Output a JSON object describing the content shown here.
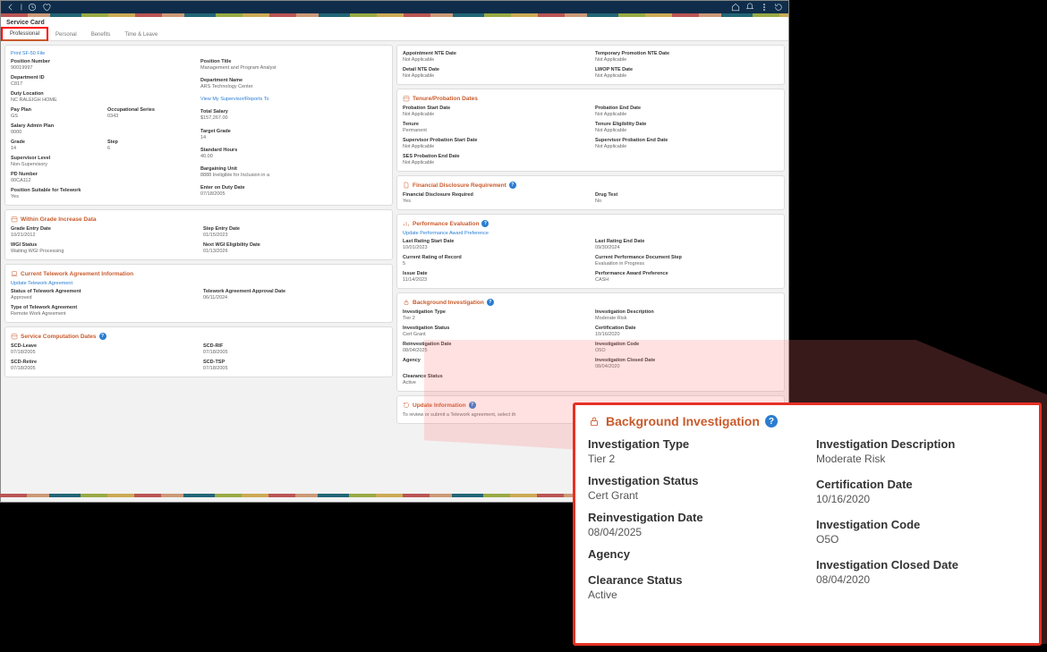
{
  "topbar": {
    "sep": "|"
  },
  "page_title": "Service Card",
  "tabs": [
    "Professional",
    "Personal",
    "Benefits",
    "Time & Leave"
  ],
  "left": {
    "profile": {
      "print": "Print SF-50 File",
      "position_number_l": "Position Number",
      "position_number": "90019997",
      "dept_id_l": "Department ID",
      "dept_id": "C817",
      "duty_loc_l": "Duty Location",
      "duty_loc": "NC RALEIGH HOME",
      "pay_plan_l": "Pay Plan",
      "pay_plan": "GS",
      "occ_series_l": "Occupational Series",
      "occ_series": "0343",
      "sal_plan_l": "Salary Admin Plan",
      "sal_plan": "0000",
      "grade_l": "Grade",
      "grade": "14",
      "step_l": "Step",
      "step": "6",
      "sup_l": "Supervisor Level",
      "sup": "Non-Supervisory",
      "pd_l": "PD Number",
      "pd": "00CA112",
      "tele_l": "Position Suitable for Telework",
      "tele": "Yes",
      "pos_title_l": "Position Title",
      "pos_title": "Management and Program Analyst",
      "dept_name_l": "Department Name",
      "dept_name": "ARS Technology Center",
      "view_sup": "View My Supervisor/Reports To",
      "total_sal_l": "Total Salary",
      "total_sal": "$157,267.00",
      "target_l": "Target Grade",
      "target": "14",
      "std_hours_l": "Standard Hours",
      "std_hours": "40.00",
      "barg_l": "Bargaining Unit",
      "barg": "8888   Ineligible for Inclusion in a",
      "eod_l": "Enter on Duty Date",
      "eod": "07/18/2005"
    },
    "wgi": {
      "title": "Within Grade Increase Data",
      "ged_l": "Grade Entry Date",
      "ged": "10/21/2012",
      "status_l": "WGI Status",
      "status": "Waiting WGI Processing",
      "sed_l": "Step Entry Date",
      "sed": "01/15/2023",
      "next_l": "Next WGI Eligibility Date",
      "next": "01/13/2026"
    },
    "tele": {
      "title": "Current Telework Agreement Information",
      "link": "Update Telework Agreement",
      "status_l": "Status of Telework Agreement",
      "status": "Approved",
      "type_l": "Type of Telework Agreement",
      "type": "Remote Work Agreement",
      "app_l": "Telework Agreement Approval Date",
      "app": "06/11/2024"
    },
    "scd": {
      "title": "Service Computation Dates",
      "leave_l": "SCD-Leave",
      "leave": "07/18/2005",
      "retire_l": "SCD-Retire",
      "retire": "07/18/2005",
      "rif_l": "SCD-RIF",
      "rif": "07/18/2005",
      "tsp_l": "SCD-TSP",
      "tsp": "07/18/2005"
    }
  },
  "right": {
    "appt": {
      "ante_l": "Appointment NTE Date",
      "ante": "Not Applicable",
      "dnte_l": "Detail NTE Date",
      "dnte": "Not Applicable",
      "tpnte_l": "Temporary Promotion NTE Date",
      "tpnte": "Not Applicable",
      "lwop_l": "LWOP NTE Date",
      "lwop": "Not Applicable"
    },
    "tenure": {
      "title": "Tenure/Probation Dates",
      "psd_l": "Probation Start Date",
      "psd": "Not Applicable",
      "ten_l": "Tenure",
      "ten": "Permanent",
      "spsd_l": "Supervisor Probation Start Date",
      "spsd": "Not Applicable",
      "ses_l": "SES Probation End Date",
      "ses": "Not Applicable",
      "ped_l": "Probation End Date",
      "ped": "Not Applicable",
      "ted_l": "Tenure Eligibility Date",
      "ted": "Not Applicable",
      "sped_l": "Supervisor Probation End Date",
      "sped": "Not Applicable"
    },
    "fin": {
      "title": "Financial Disclosure Requirement",
      "fdr_l": "Financial Disclosure Required",
      "fdr": "Yes",
      "drug_l": "Drug Test",
      "drug": "No"
    },
    "perf": {
      "title": "Performance Evaluation",
      "link": "Update Performance Award Preference",
      "lrsd_l": "Last Rating Start Date",
      "lrsd": "10/01/2023",
      "crr_l": "Current Rating of Record",
      "crr": "5",
      "iss_l": "Issue Date",
      "iss": "11/14/2023",
      "lred_l": "Last Rating End Date",
      "lred": "09/30/2024",
      "cpds_l": "Current Performance Document Step",
      "cpds": "Evaluation in Progress",
      "pap_l": "Performance Award Preference",
      "pap": "CASH"
    },
    "bg": {
      "title": "Background Investigation",
      "itype_l": "Investigation Type",
      "itype": "Tier 2",
      "istat_l": "Investigation Status",
      "istat": "Cert Grant",
      "rein_l": "Reinvestigation Date",
      "rein": "08/04/2025",
      "ag_l": "Agency",
      "ag": "",
      "cls_l": "Clearance Status",
      "cls": "Active",
      "idesc_l": "Investigation Description",
      "idesc": "Moderate Risk",
      "cert_l": "Certification Date",
      "cert": "10/16/2020",
      "icode_l": "Investigation Code",
      "icode": "O5O",
      "iclosed_l": "Investigation Closed Date",
      "iclosed": "08/04/2020"
    },
    "upd": {
      "title": "Update Information",
      "txt": "To review or submit a Telework agreement, select th"
    }
  },
  "callout": {
    "title": "Background Investigation",
    "itype_l": "Investigation Type",
    "itype": "Tier 2",
    "istat_l": "Investigation Status",
    "istat": "Cert Grant",
    "rein_l": "Reinvestigation Date",
    "rein": "08/04/2025",
    "ag_l": "Agency",
    "ag": "",
    "cls_l": "Clearance Status",
    "cls": "Active",
    "idesc_l": "Investigation Description",
    "idesc": "Moderate Risk",
    "cert_l": "Certification Date",
    "cert": "10/16/2020",
    "icode_l": "Investigation Code",
    "icode": "O5O",
    "iclosed_l": "Investigation Closed Date",
    "iclosed": "08/04/2020"
  }
}
